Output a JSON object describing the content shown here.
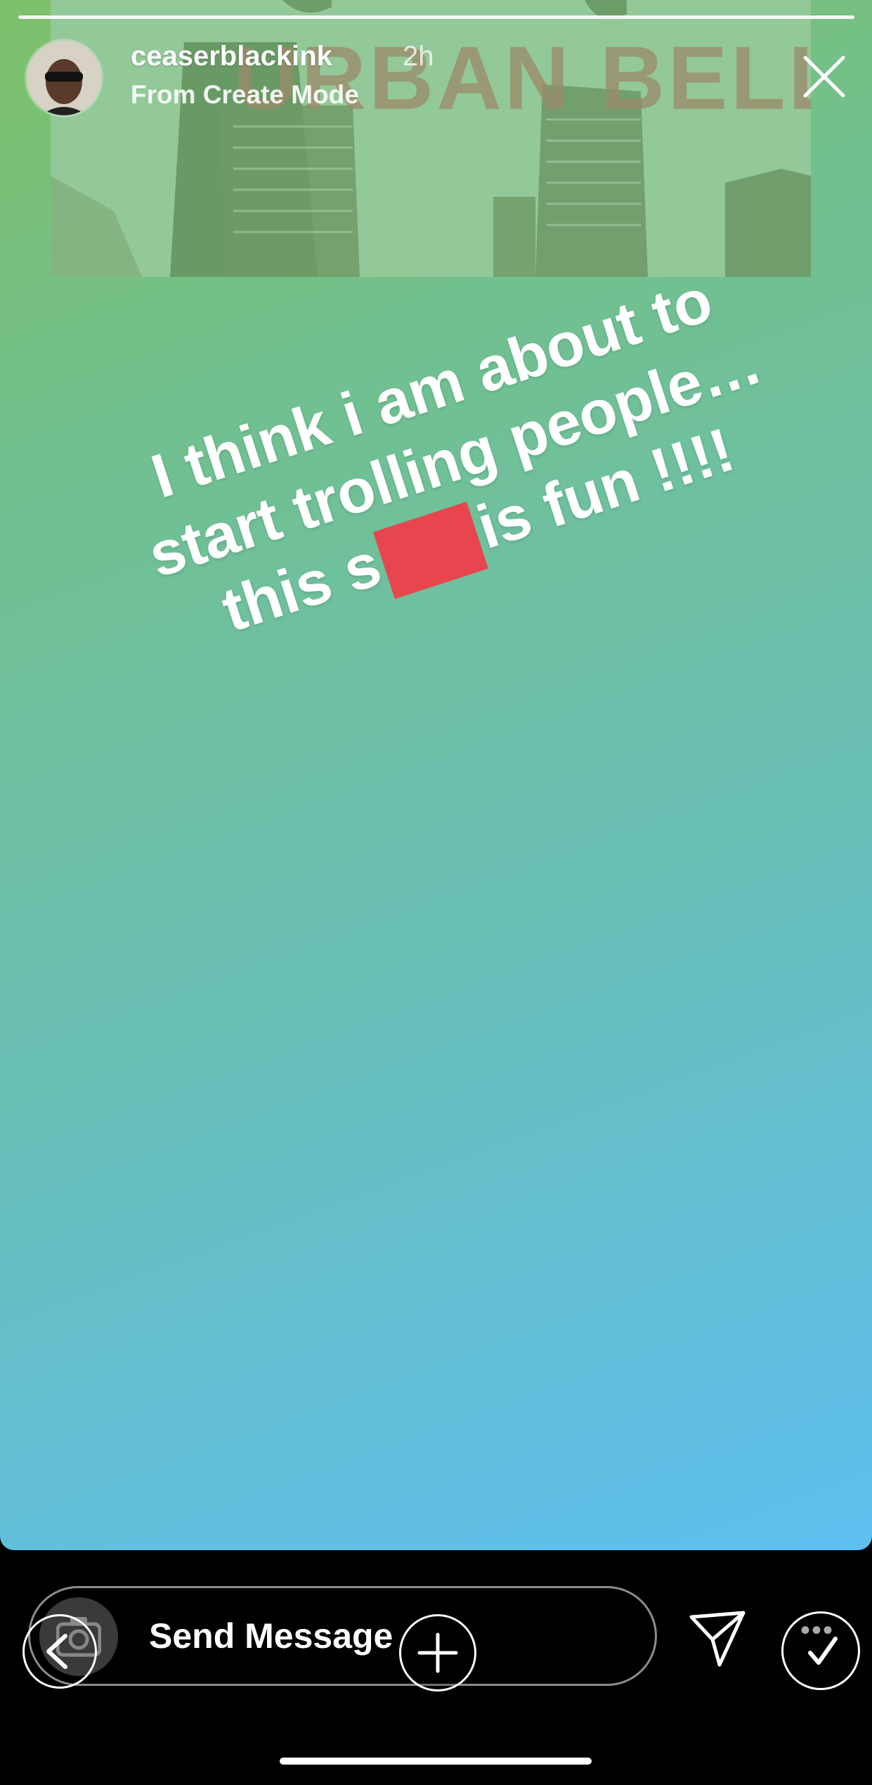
{
  "story": {
    "progress_segments": 1,
    "background_colors": [
      "#7ec06a",
      "#5fbff0"
    ]
  },
  "header": {
    "username": "ceaserblackink",
    "time": "2h",
    "subtitle": "From Create Mode"
  },
  "sticker": {
    "title": "URBAN BELLE"
  },
  "caption": {
    "line1": "I think i am about to",
    "line2": "start trolling people…",
    "line3_prefix": "this s",
    "line3_suffix": "is fun !!!!",
    "redaction_color": "#e8464e"
  },
  "footer": {
    "message_placeholder": "Send Message",
    "icons": [
      "camera-icon",
      "back-icon",
      "add-icon",
      "direct-share-icon",
      "checkmark-icon"
    ]
  }
}
